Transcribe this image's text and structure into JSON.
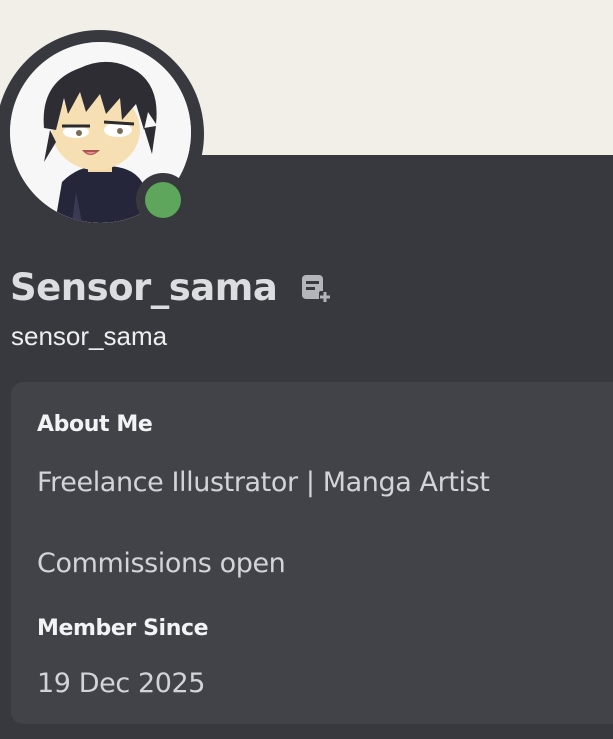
{
  "profile": {
    "display_name": "Sensor_sama",
    "username": "sensor_sama",
    "status": "online",
    "status_color": "#5da65b",
    "banner_color": "#f2eee8",
    "avatar_icon": "anime-character-avatar",
    "note_icon": "add-note-icon"
  },
  "about": {
    "title": "About Me",
    "lines": [
      "Freelance Illustrator | Manga Artist",
      "Commissions open"
    ]
  },
  "member_since": {
    "title": "Member Since",
    "date": "19 Dec 2025"
  }
}
